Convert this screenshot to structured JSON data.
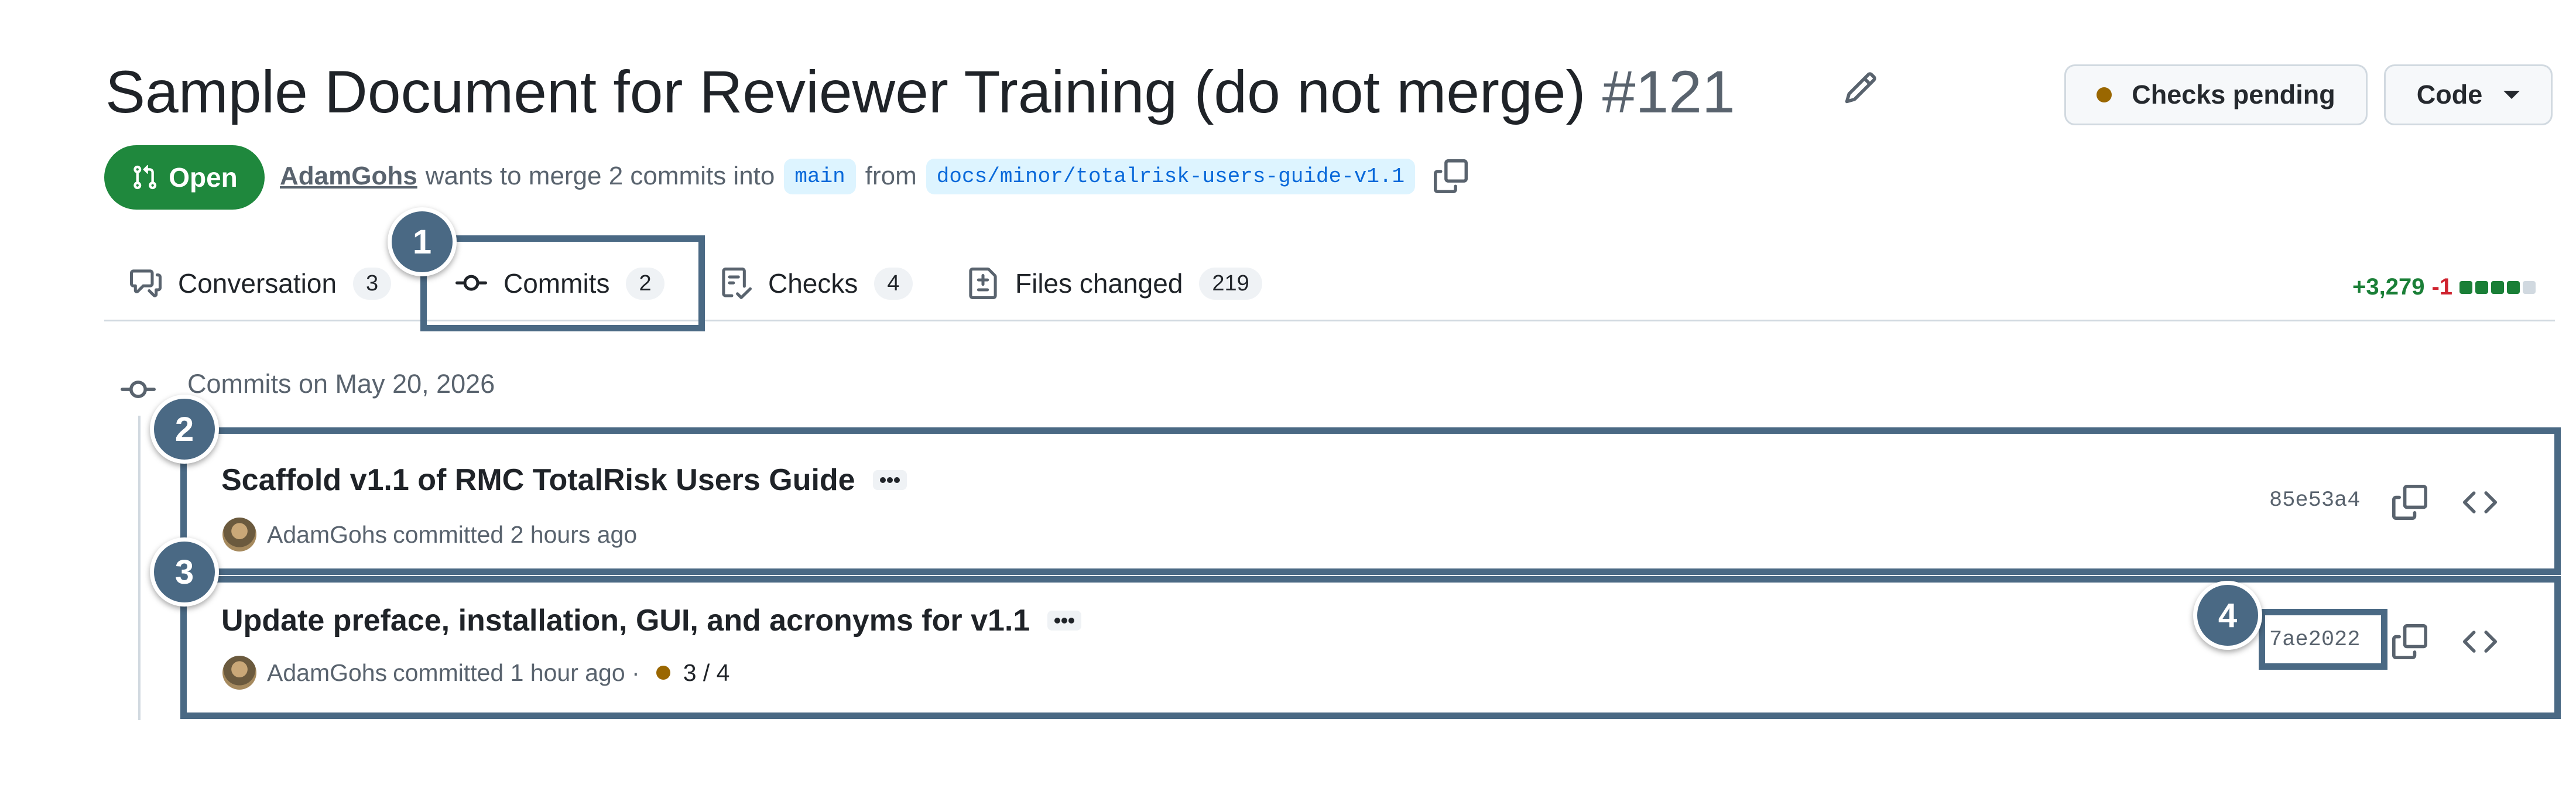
{
  "header": {
    "title": "Sample Document for Reviewer Training (do not merge)",
    "number": "#121",
    "checks_button": "Checks pending",
    "code_button": "Code"
  },
  "pr_meta": {
    "state": "Open",
    "author": "AdamGohs",
    "text_merge": "wants to merge 2 commits into",
    "base_branch": "main",
    "text_from": "from",
    "head_branch": "docs/minor/totalrisk-users-guide-v1.1"
  },
  "tabs": [
    {
      "label": "Conversation",
      "count": "3",
      "icon": "comment-discussion-icon"
    },
    {
      "label": "Commits",
      "count": "2",
      "icon": "git-commit-icon"
    },
    {
      "label": "Checks",
      "count": "4",
      "icon": "checklist-icon"
    },
    {
      "label": "Files changed",
      "count": "219",
      "icon": "file-diff-icon"
    }
  ],
  "diffstat": {
    "additions": "+3,279",
    "deletions": "-1",
    "blocks": [
      "#1a7f37",
      "#1a7f37",
      "#1a7f37",
      "#1a7f37",
      "#d1d9e0"
    ]
  },
  "commits_group": {
    "date_heading": "Commits on May 20, 2026",
    "commits": [
      {
        "title": "Scaffold v1.1 of RMC TotalRisk Users Guide",
        "author": "AdamGohs",
        "meta": "committed 2 hours ago",
        "sha": "85e53a4"
      },
      {
        "title": "Update preface, installation, GUI, and acronyms for v1.1",
        "author": "AdamGohs",
        "meta": "committed 1 hour ago ·",
        "status": "3 / 4",
        "sha": "7ae2022"
      }
    ]
  },
  "callouts": [
    "1",
    "2",
    "3",
    "4"
  ],
  "colors": {
    "callout": "#4a6984",
    "open_badge": "#1f883d",
    "pending": "#9a6700",
    "link": "#0969da"
  }
}
